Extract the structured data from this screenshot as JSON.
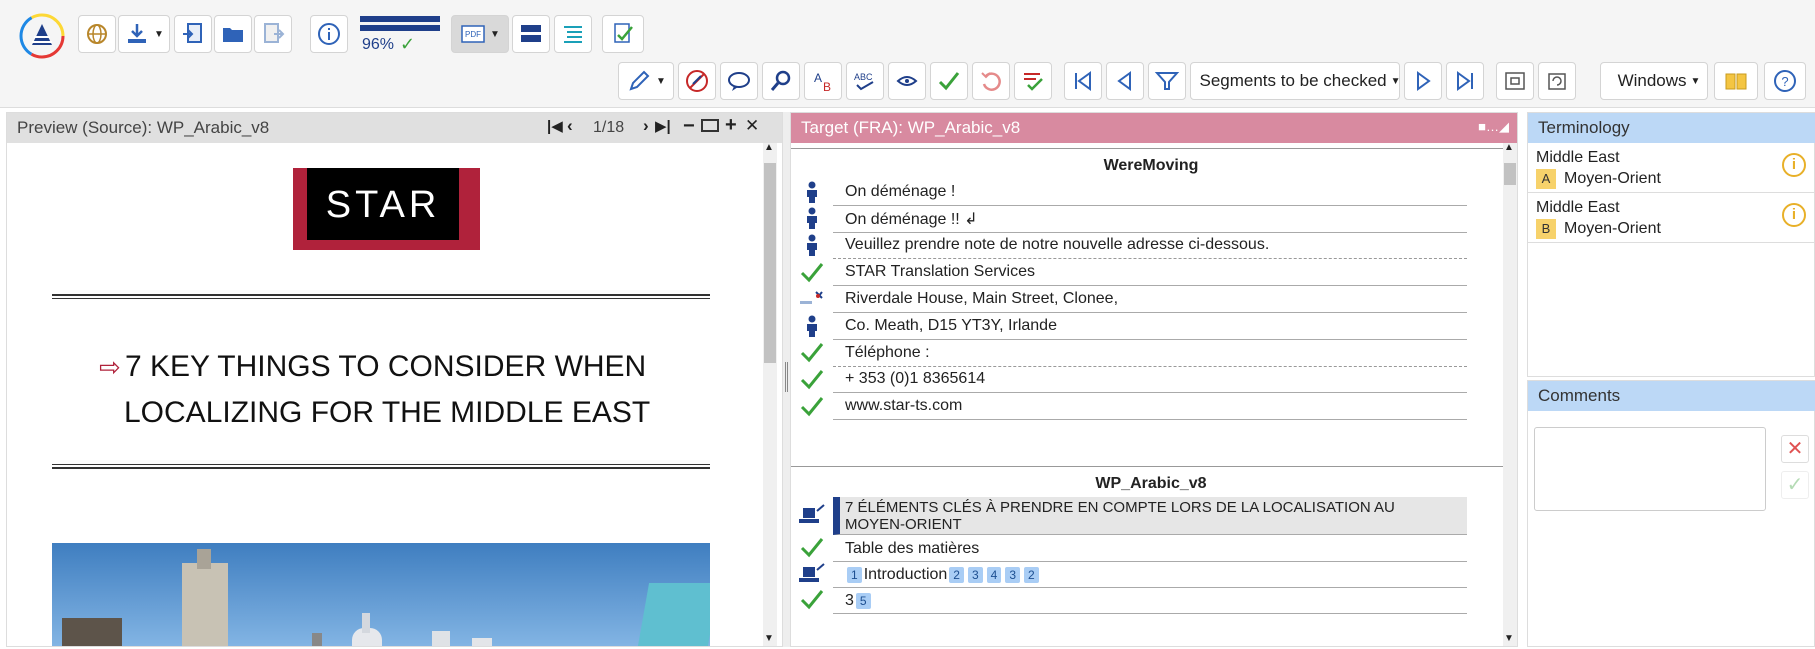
{
  "toolbar": {
    "progress_percent": "96%",
    "progress_value": 0.96,
    "segments_filter_label": "Segments to be checked",
    "windows_label": "Windows"
  },
  "source": {
    "title": "Preview (Source): WP_Arabic_v8",
    "page_indicator": "1/18",
    "logo_text": "STAR",
    "heading_line1": "7 KEY THINGS TO CONSIDER WHEN",
    "heading_line2": "LOCALIZING FOR THE MIDDLE EAST"
  },
  "target": {
    "title": "Target (FRA): WP_Arabic_v8",
    "group1_title": "WereMoving",
    "group2_title": "WP_Arabic_v8",
    "segments": [
      {
        "text": "On déménage !",
        "status": "person"
      },
      {
        "text": "On déménage !! ↲",
        "status": "person"
      },
      {
        "text": "Veuillez prendre note de notre nouvelle adresse ci-dessous.",
        "status": "person"
      },
      {
        "text": "STAR Translation Services",
        "status": "check"
      },
      {
        "text": "Riverdale House, Main Street, Clonee,",
        "status": "edit"
      },
      {
        "text": "Co. Meath, D15 YT3Y, Irlande",
        "status": "person"
      },
      {
        "text": "Téléphone :",
        "status": "check"
      },
      {
        "text": "+ 353 (0)1 8365614",
        "status": "check"
      },
      {
        "text": "www.star-ts.com",
        "status": "check"
      }
    ],
    "segments2": [
      {
        "line1": "7 ÉLÉMENTS CLÉS À PRENDRE EN COMPTE LORS DE LA LOCALISATION AU",
        "line2": "MOYEN-ORIENT",
        "status": "stamp"
      },
      {
        "text": "Table des matières",
        "status": "check"
      },
      {
        "text": "Introduction",
        "status": "stamp",
        "tags": [
          "1",
          "2",
          "3",
          "4",
          "3",
          "2"
        ]
      },
      {
        "text": "3",
        "status": "check",
        "tags": [
          "5"
        ]
      }
    ]
  },
  "terminology": {
    "title": "Terminology",
    "items": [
      {
        "source": "Middle East",
        "letter": "A",
        "target": "Moyen-Orient"
      },
      {
        "source": "Middle East",
        "letter": "B",
        "target": "Moyen-Orient"
      }
    ]
  },
  "comments": {
    "title": "Comments"
  },
  "colors": {
    "accent_blue": "#1f3f8a",
    "target_header": "#d88aa0",
    "terminology_header": "#bcd8f6",
    "check_green": "#3aa23a"
  }
}
